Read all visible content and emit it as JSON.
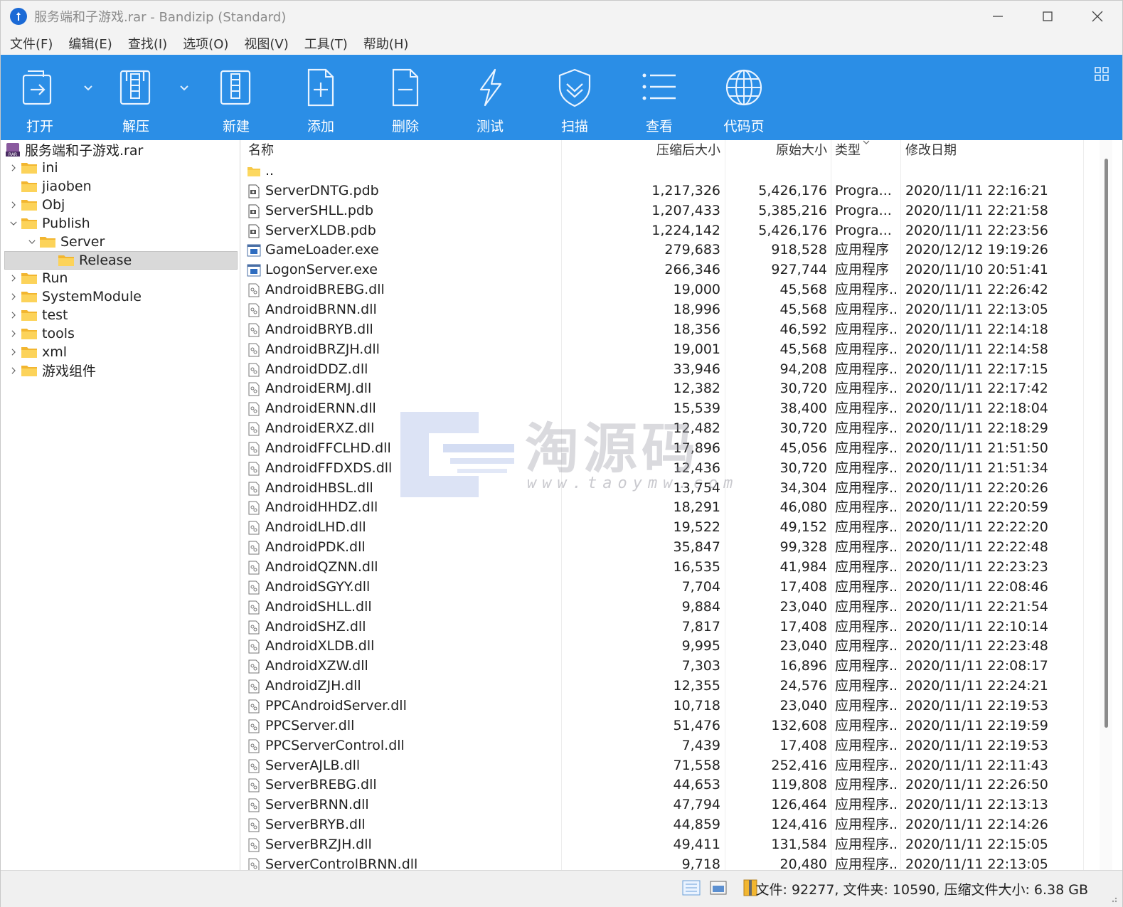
{
  "window": {
    "title": "服务端和子游戏.rar - Bandizip (Standard)"
  },
  "menu": [
    "文件(F)",
    "编辑(E)",
    "查找(I)",
    "选项(O)",
    "视图(V)",
    "工具(T)",
    "帮助(H)"
  ],
  "toolbar": [
    {
      "label": "打开",
      "icon": "open-archive-icon"
    },
    {
      "label": "解压",
      "icon": "extract-zip-icon"
    },
    {
      "label": "新建",
      "icon": "new-archive-icon"
    },
    {
      "label": "添加",
      "icon": "add-file-icon"
    },
    {
      "label": "删除",
      "icon": "delete-file-icon"
    },
    {
      "label": "测试",
      "icon": "lightning-test-icon"
    },
    {
      "label": "扫描",
      "icon": "shield-scan-icon"
    },
    {
      "label": "查看",
      "icon": "list-view-icon"
    },
    {
      "label": "代码页",
      "icon": "globe-codepage-icon"
    }
  ],
  "tree": {
    "root": "服务端和子游戏.rar",
    "items": [
      {
        "label": "ini",
        "expander": "collapsed",
        "level": 1
      },
      {
        "label": "jiaoben",
        "expander": "none",
        "level": 1
      },
      {
        "label": "Obj",
        "expander": "collapsed",
        "level": 1
      },
      {
        "label": "Publish",
        "expander": "expanded",
        "level": 1
      },
      {
        "label": "Server",
        "expander": "expanded",
        "level": 2
      },
      {
        "label": "Release",
        "expander": "none",
        "level": 3,
        "selected": true
      },
      {
        "label": "Run",
        "expander": "collapsed",
        "level": 1
      },
      {
        "label": "SystemModule",
        "expander": "collapsed",
        "level": 1
      },
      {
        "label": "test",
        "expander": "collapsed",
        "level": 1
      },
      {
        "label": "tools",
        "expander": "collapsed",
        "level": 1
      },
      {
        "label": "xml",
        "expander": "collapsed",
        "level": 1
      },
      {
        "label": "游戏组件",
        "expander": "collapsed",
        "level": 1
      }
    ]
  },
  "list": {
    "columns": {
      "name": "名称",
      "packed": "压缩后大小",
      "size": "原始大小",
      "type": "类型",
      "modified": "修改日期"
    },
    "parent_entry": "..",
    "rows": [
      {
        "name": "ServerDNTG.pdb",
        "kind": "pdb",
        "packed": "1,217,326",
        "size": "5,426,176",
        "type": "Progra...",
        "modified": "2020/11/11 22:16:21"
      },
      {
        "name": "ServerSHLL.pdb",
        "kind": "pdb",
        "packed": "1,207,433",
        "size": "5,385,216",
        "type": "Progra...",
        "modified": "2020/11/11 22:21:58"
      },
      {
        "name": "ServerXLDB.pdb",
        "kind": "pdb",
        "packed": "1,224,142",
        "size": "5,426,176",
        "type": "Progra...",
        "modified": "2020/11/11 22:23:56"
      },
      {
        "name": "GameLoader.exe",
        "kind": "exe",
        "packed": "279,683",
        "size": "918,528",
        "type": "应用程序",
        "modified": "2020/12/12 19:19:26"
      },
      {
        "name": "LogonServer.exe",
        "kind": "exe",
        "packed": "266,346",
        "size": "927,744",
        "type": "应用程序",
        "modified": "2020/11/10 20:51:41"
      },
      {
        "name": "AndroidBREBG.dll",
        "kind": "dll",
        "packed": "19,000",
        "size": "45,568",
        "type": "应用程序...",
        "modified": "2020/11/11 22:26:42"
      },
      {
        "name": "AndroidBRNN.dll",
        "kind": "dll",
        "packed": "18,996",
        "size": "45,568",
        "type": "应用程序...",
        "modified": "2020/11/11 22:13:05"
      },
      {
        "name": "AndroidBRYB.dll",
        "kind": "dll",
        "packed": "18,356",
        "size": "46,592",
        "type": "应用程序...",
        "modified": "2020/11/11 22:14:18"
      },
      {
        "name": "AndroidBRZJH.dll",
        "kind": "dll",
        "packed": "19,001",
        "size": "45,568",
        "type": "应用程序...",
        "modified": "2020/11/11 22:14:58"
      },
      {
        "name": "AndroidDDZ.dll",
        "kind": "dll",
        "packed": "33,946",
        "size": "94,208",
        "type": "应用程序...",
        "modified": "2020/11/11 22:17:15"
      },
      {
        "name": "AndroidERMJ.dll",
        "kind": "dll",
        "packed": "12,382",
        "size": "30,720",
        "type": "应用程序...",
        "modified": "2020/11/11 22:17:42"
      },
      {
        "name": "AndroidERNN.dll",
        "kind": "dll",
        "packed": "15,539",
        "size": "38,400",
        "type": "应用程序...",
        "modified": "2020/11/11 22:18:04"
      },
      {
        "name": "AndroidERXZ.dll",
        "kind": "dll",
        "packed": "12,482",
        "size": "30,720",
        "type": "应用程序...",
        "modified": "2020/11/11 22:18:29"
      },
      {
        "name": "AndroidFFCLHD.dll",
        "kind": "dll",
        "packed": "17,896",
        "size": "45,056",
        "type": "应用程序...",
        "modified": "2020/11/11 21:51:50"
      },
      {
        "name": "AndroidFFDXDS.dll",
        "kind": "dll",
        "packed": "12,436",
        "size": "30,720",
        "type": "应用程序...",
        "modified": "2020/11/11 21:51:34"
      },
      {
        "name": "AndroidHBSL.dll",
        "kind": "dll",
        "packed": "13,754",
        "size": "34,304",
        "type": "应用程序...",
        "modified": "2020/11/11 22:20:26"
      },
      {
        "name": "AndroidHHDZ.dll",
        "kind": "dll",
        "packed": "18,291",
        "size": "46,080",
        "type": "应用程序...",
        "modified": "2020/11/11 22:20:59"
      },
      {
        "name": "AndroidLHD.dll",
        "kind": "dll",
        "packed": "19,522",
        "size": "49,152",
        "type": "应用程序...",
        "modified": "2020/11/11 22:22:20"
      },
      {
        "name": "AndroidPDK.dll",
        "kind": "dll",
        "packed": "35,847",
        "size": "99,328",
        "type": "应用程序...",
        "modified": "2020/11/11 22:22:48"
      },
      {
        "name": "AndroidQZNN.dll",
        "kind": "dll",
        "packed": "16,535",
        "size": "41,984",
        "type": "应用程序...",
        "modified": "2020/11/11 22:23:23"
      },
      {
        "name": "AndroidSGYY.dll",
        "kind": "dll",
        "packed": "7,704",
        "size": "17,408",
        "type": "应用程序...",
        "modified": "2020/11/11 22:08:46"
      },
      {
        "name": "AndroidSHLL.dll",
        "kind": "dll",
        "packed": "9,884",
        "size": "23,040",
        "type": "应用程序...",
        "modified": "2020/11/11 22:21:54"
      },
      {
        "name": "AndroidSHZ.dll",
        "kind": "dll",
        "packed": "7,817",
        "size": "17,408",
        "type": "应用程序...",
        "modified": "2020/11/11 22:10:14"
      },
      {
        "name": "AndroidXLDB.dll",
        "kind": "dll",
        "packed": "9,995",
        "size": "23,040",
        "type": "应用程序...",
        "modified": "2020/11/11 22:23:48"
      },
      {
        "name": "AndroidXZW.dll",
        "kind": "dll",
        "packed": "7,303",
        "size": "16,896",
        "type": "应用程序...",
        "modified": "2020/11/11 22:08:17"
      },
      {
        "name": "AndroidZJH.dll",
        "kind": "dll",
        "packed": "12,355",
        "size": "24,576",
        "type": "应用程序...",
        "modified": "2020/11/11 22:24:21"
      },
      {
        "name": "PPCAndroidServer.dll",
        "kind": "dll",
        "packed": "10,718",
        "size": "23,040",
        "type": "应用程序...",
        "modified": "2020/11/11 22:19:53"
      },
      {
        "name": "PPCServer.dll",
        "kind": "dll",
        "packed": "51,476",
        "size": "132,608",
        "type": "应用程序...",
        "modified": "2020/11/11 22:19:59"
      },
      {
        "name": "PPCServerControl.dll",
        "kind": "dll",
        "packed": "7,439",
        "size": "17,408",
        "type": "应用程序...",
        "modified": "2020/11/11 22:19:53"
      },
      {
        "name": "ServerAJLB.dll",
        "kind": "dll",
        "packed": "71,558",
        "size": "252,416",
        "type": "应用程序...",
        "modified": "2020/11/11 22:11:43"
      },
      {
        "name": "ServerBREBG.dll",
        "kind": "dll",
        "packed": "44,653",
        "size": "119,808",
        "type": "应用程序...",
        "modified": "2020/11/11 22:26:50"
      },
      {
        "name": "ServerBRNN.dll",
        "kind": "dll",
        "packed": "47,794",
        "size": "126,464",
        "type": "应用程序...",
        "modified": "2020/11/11 22:13:13"
      },
      {
        "name": "ServerBRYB.dll",
        "kind": "dll",
        "packed": "44,859",
        "size": "124,416",
        "type": "应用程序...",
        "modified": "2020/11/11 22:14:26"
      },
      {
        "name": "ServerBRZJH.dll",
        "kind": "dll",
        "packed": "49,411",
        "size": "131,584",
        "type": "应用程序...",
        "modified": "2020/11/11 22:15:05"
      },
      {
        "name": "ServerControlBRNN.dll",
        "kind": "dll",
        "packed": "9,718",
        "size": "20,480",
        "type": "应用程序...",
        "modified": "2020/11/11 22:13:05"
      }
    ]
  },
  "watermark": {
    "text": "淘源码",
    "url": "www.taoymw.com"
  },
  "status": {
    "text": "文件: 92277, 文件夹: 10590, 压缩文件大小: 6.38 GB"
  },
  "colors": {
    "toolbar_bg": "#2b8ee6",
    "titlebar_bg": "#f3f3f3",
    "folder": "#f7c948",
    "selection": "#d9d9d9"
  }
}
